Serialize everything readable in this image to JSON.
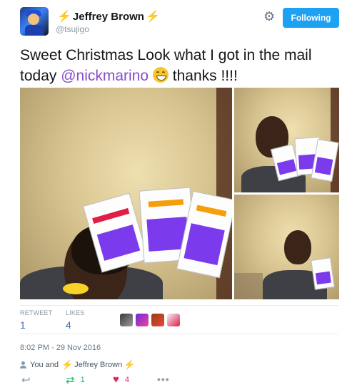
{
  "user": {
    "display_name": "Jeffrey Brown",
    "handle": "@tsujigo",
    "name_prefix_icon": "lightning-bolt-icon",
    "name_suffix_icon": "lightning-bolt-icon"
  },
  "header": {
    "follow_button_label": "Following",
    "settings_icon": "gear-icon"
  },
  "tweet": {
    "text_part1": "Sweet Christmas Look what I got in the mail today",
    "mention": "@nickmarino",
    "emoji": "grinning-face-icon",
    "text_part2": "thanks !!!!"
  },
  "stats": {
    "retweets_label": "RETWEET",
    "retweets_value": "1",
    "likes_label": "LIKES",
    "likes_value": "4"
  },
  "timestamp": "8:02 PM - 29 Nov 2016",
  "liked_by": {
    "you": "You and",
    "name": "Jeffrey Brown"
  },
  "actions": {
    "retweet_count": "1",
    "like_count": "4"
  },
  "colors": {
    "follow_button": "#1da1f2",
    "mention": "#8a4cc7",
    "retweet_green": "#17bf63",
    "like_red": "#e0245e",
    "bolt": "#f5a623"
  }
}
